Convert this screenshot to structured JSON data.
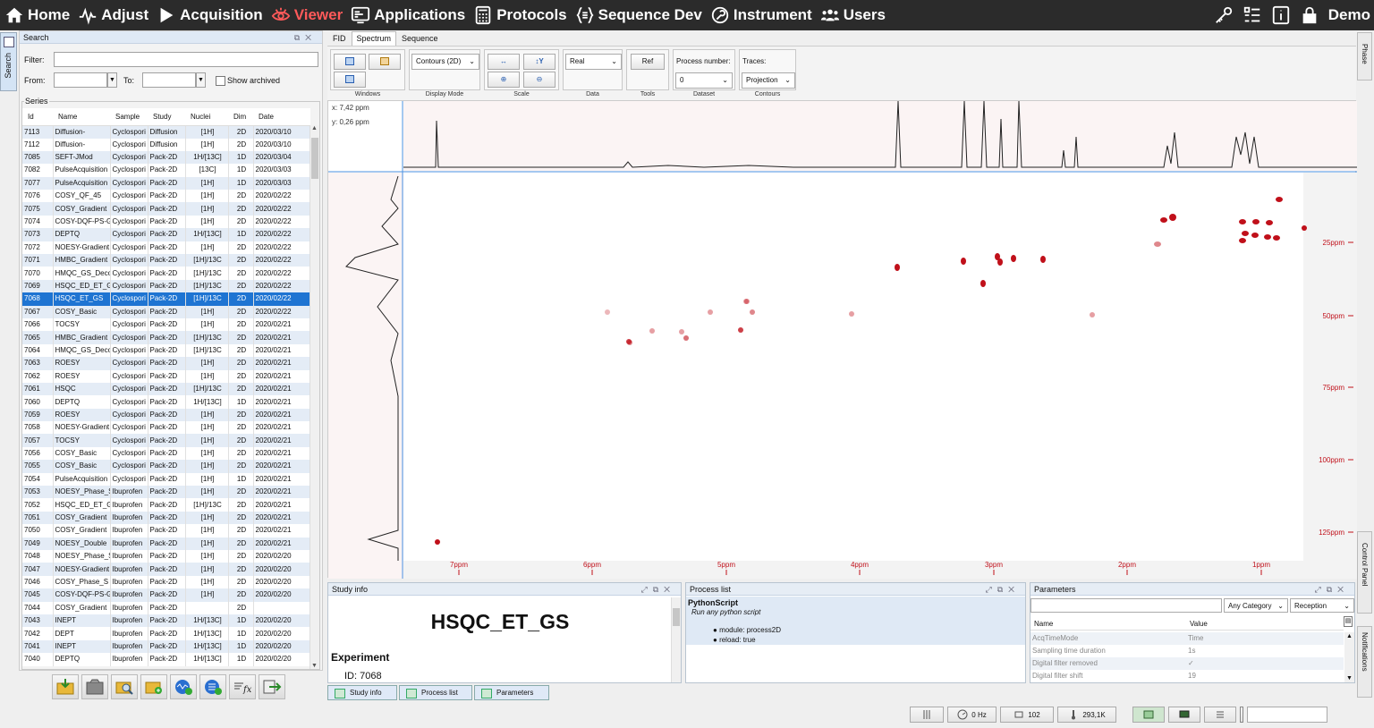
{
  "nav": {
    "items": [
      {
        "label": "Home",
        "icon": "home-icon"
      },
      {
        "label": "Adjust",
        "icon": "pulse-icon"
      },
      {
        "label": "Acquisition",
        "icon": "play-icon"
      },
      {
        "label": "Viewer",
        "icon": "eye-icon"
      },
      {
        "label": "Applications",
        "icon": "monitor-icon"
      },
      {
        "label": "Protocols",
        "icon": "calculator-icon"
      },
      {
        "label": "Sequence Dev",
        "icon": "braces-icon"
      },
      {
        "label": "Instrument",
        "icon": "wrench-icon"
      },
      {
        "label": "Users",
        "icon": "users-icon"
      }
    ],
    "active": "Viewer",
    "user": "Demo"
  },
  "sidetab": {
    "label": "Search"
  },
  "search": {
    "title": "Search",
    "filter_label": "Filter:",
    "from_label": "From:",
    "to_label": "To:",
    "show_archived": "Show archived",
    "series_label": "Series",
    "columns": [
      "Id",
      "Name",
      "Sample",
      "Study",
      "Nuclei",
      "Dim",
      "Date"
    ],
    "selected_id": "7068",
    "rows": [
      [
        "7113",
        "Diffusion-",
        "Cyclospori",
        "Diffusion",
        "[1H]",
        "2D",
        "2020/03/10"
      ],
      [
        "7112",
        "Diffusion-",
        "Cyclospori",
        "Diffusion",
        "[1H]",
        "2D",
        "2020/03/10"
      ],
      [
        "7085",
        "SEFT-JMod",
        "Cyclospori",
        "Pack-2D",
        "1H/[13C]",
        "1D",
        "2020/03/04"
      ],
      [
        "7082",
        "PulseAcquisition",
        "Cyclospori",
        "Pack-2D",
        "[13C]",
        "1D",
        "2020/03/03"
      ],
      [
        "7077",
        "PulseAcquisition",
        "Cyclospori",
        "Pack-2D",
        "[1H]",
        "1D",
        "2020/03/03"
      ],
      [
        "7076",
        "COSY_QF_45",
        "Cyclospori",
        "Pack-2D",
        "[1H]",
        "2D",
        "2020/02/22"
      ],
      [
        "7075",
        "COSY_Gradient",
        "Cyclospori",
        "Pack-2D",
        "[1H]",
        "2D",
        "2020/02/22"
      ],
      [
        "7074",
        "COSY-DQF-PS-G",
        "Cyclospori",
        "Pack-2D",
        "[1H]",
        "2D",
        "2020/02/22"
      ],
      [
        "7073",
        "DEPTQ",
        "Cyclospori",
        "Pack-2D",
        "1H/[13C]",
        "1D",
        "2020/02/22"
      ],
      [
        "7072",
        "NOESY-Gradient",
        "Cyclospori",
        "Pack-2D",
        "[1H]",
        "2D",
        "2020/02/22"
      ],
      [
        "7071",
        "HMBC_Gradient",
        "Cyclospori",
        "Pack-2D",
        "[1H]/13C",
        "2D",
        "2020/02/22"
      ],
      [
        "7070",
        "HMQC_GS_Deco",
        "Cyclospori",
        "Pack-2D",
        "[1H]/13C",
        "2D",
        "2020/02/22"
      ],
      [
        "7069",
        "HSQC_ED_ET_G",
        "Cyclospori",
        "Pack-2D",
        "[1H]/13C",
        "2D",
        "2020/02/22"
      ],
      [
        "7068",
        "HSQC_ET_GS",
        "Cyclospori",
        "Pack-2D",
        "[1H]/13C",
        "2D",
        "2020/02/22"
      ],
      [
        "7067",
        "COSY_Basic",
        "Cyclospori",
        "Pack-2D",
        "[1H]",
        "2D",
        "2020/02/22"
      ],
      [
        "7066",
        "TOCSY",
        "Cyclospori",
        "Pack-2D",
        "[1H]",
        "2D",
        "2020/02/21"
      ],
      [
        "7065",
        "HMBC_Gradient",
        "Cyclospori",
        "Pack-2D",
        "[1H]/13C",
        "2D",
        "2020/02/21"
      ],
      [
        "7064",
        "HMQC_GS_Deco",
        "Cyclospori",
        "Pack-2D",
        "[1H]/13C",
        "2D",
        "2020/02/21"
      ],
      [
        "7063",
        "ROESY",
        "Cyclospori",
        "Pack-2D",
        "[1H]",
        "2D",
        "2020/02/21"
      ],
      [
        "7062",
        "ROESY",
        "Cyclospori",
        "Pack-2D",
        "[1H]",
        "2D",
        "2020/02/21"
      ],
      [
        "7061",
        "HSQC",
        "Cyclospori",
        "Pack-2D",
        "[1H]/13C",
        "2D",
        "2020/02/21"
      ],
      [
        "7060",
        "DEPTQ",
        "Cyclospori",
        "Pack-2D",
        "1H/[13C]",
        "1D",
        "2020/02/21"
      ],
      [
        "7059",
        "ROESY",
        "Cyclospori",
        "Pack-2D",
        "[1H]",
        "2D",
        "2020/02/21"
      ],
      [
        "7058",
        "NOESY-Gradient",
        "Cyclospori",
        "Pack-2D",
        "[1H]",
        "2D",
        "2020/02/21"
      ],
      [
        "7057",
        "TOCSY",
        "Cyclospori",
        "Pack-2D",
        "[1H]",
        "2D",
        "2020/02/21"
      ],
      [
        "7056",
        "COSY_Basic",
        "Cyclospori",
        "Pack-2D",
        "[1H]",
        "2D",
        "2020/02/21"
      ],
      [
        "7055",
        "COSY_Basic",
        "Cyclospori",
        "Pack-2D",
        "[1H]",
        "2D",
        "2020/02/21"
      ],
      [
        "7054",
        "PulseAcquisition",
        "Cyclospori",
        "Pack-2D",
        "[1H]",
        "1D",
        "2020/02/21"
      ],
      [
        "7053",
        "NOESY_Phase_S",
        "Ibuprofen",
        "Pack-2D",
        "[1H]",
        "2D",
        "2020/02/21"
      ],
      [
        "7052",
        "HSQC_ED_ET_G",
        "Ibuprofen",
        "Pack-2D",
        "[1H]/13C",
        "2D",
        "2020/02/21"
      ],
      [
        "7051",
        "COSY_Gradient",
        "Ibuprofen",
        "Pack-2D",
        "[1H]",
        "2D",
        "2020/02/21"
      ],
      [
        "7050",
        "COSY_Gradient",
        "Ibuprofen",
        "Pack-2D",
        "[1H]",
        "2D",
        "2020/02/21"
      ],
      [
        "7049",
        "NOESY_Double",
        "Ibuprofen",
        "Pack-2D",
        "[1H]",
        "2D",
        "2020/02/21"
      ],
      [
        "7048",
        "NOESY_Phase_S",
        "Ibuprofen",
        "Pack-2D",
        "[1H]",
        "2D",
        "2020/02/20"
      ],
      [
        "7047",
        "NOESY-Gradient",
        "Ibuprofen",
        "Pack-2D",
        "[1H]",
        "2D",
        "2020/02/20"
      ],
      [
        "7046",
        "COSY_Phase_S",
        "Ibuprofen",
        "Pack-2D",
        "[1H]",
        "2D",
        "2020/02/20"
      ],
      [
        "7045",
        "COSY-DQF-PS-G",
        "Ibuprofen",
        "Pack-2D",
        "[1H]",
        "2D",
        "2020/02/20"
      ],
      [
        "7044",
        "COSY_Gradient",
        "Ibuprofen",
        "Pack-2D",
        "",
        "2D",
        ""
      ],
      [
        "7043",
        "INEPT",
        "Ibuprofen",
        "Pack-2D",
        "1H/[13C]",
        "1D",
        "2020/02/20"
      ],
      [
        "7042",
        "DEPT",
        "Ibuprofen",
        "Pack-2D",
        "1H/[13C]",
        "1D",
        "2020/02/20"
      ],
      [
        "7041",
        "INEPT",
        "Ibuprofen",
        "Pack-2D",
        "1H/[13C]",
        "1D",
        "2020/02/20"
      ],
      [
        "7040",
        "DEPTQ",
        "Ibuprofen",
        "Pack-2D",
        "1H/[13C]",
        "1D",
        "2020/02/20"
      ]
    ]
  },
  "viewer": {
    "tabs": [
      "FID",
      "Spectrum",
      "Sequence"
    ],
    "active_tab": "Spectrum",
    "toolbar": {
      "groups": [
        "Windows",
        "Display Mode",
        "Scale",
        "Data",
        "Tools",
        "Dataset",
        "Contours"
      ],
      "display_mode": "Contours (2D)",
      "data": "Real",
      "ref": "Ref",
      "process_number_label": "Process number:",
      "process_number": "0",
      "traces_label": "Traces:",
      "traces": "Projection"
    },
    "cursor": {
      "x": "x: 7,42 ppm",
      "y": "y: 0,26 ppm"
    },
    "x_ticks": [
      "7ppm",
      "6ppm",
      "5ppm",
      "4ppm",
      "3ppm",
      "2ppm",
      "1ppm"
    ],
    "y_ticks": [
      "25ppm",
      "50ppm",
      "75ppm",
      "100ppm",
      "125ppm"
    ],
    "peak_color": "#c0101a"
  },
  "study_info": {
    "title": "Study info",
    "heading": "HSQC_ET_GS",
    "section": "Experiment",
    "id_line": "ID: 7068"
  },
  "process_list": {
    "title": "Process list",
    "script_name": "PythonScript",
    "script_desc": "Run any python script",
    "module": "module: process2D",
    "reload": "reload: true"
  },
  "parameters": {
    "title": "Parameters",
    "category": "Any Category",
    "reception": "Reception",
    "col_name": "Name",
    "col_value": "Value",
    "rows": [
      [
        "AcqTimeMode",
        "Time"
      ],
      [
        "Sampling time duration",
        "1s"
      ],
      [
        "Digital filter removed",
        "✓"
      ],
      [
        "Digital filter shift",
        "19"
      ]
    ]
  },
  "bottom_tabs": [
    "Study info",
    "Process list",
    "Parameters"
  ],
  "right_tabs": [
    "Phase",
    "Control Panel",
    "Notifications"
  ],
  "status": {
    "freq": "0 Hz",
    "count": "102",
    "temp": "293,1K"
  }
}
